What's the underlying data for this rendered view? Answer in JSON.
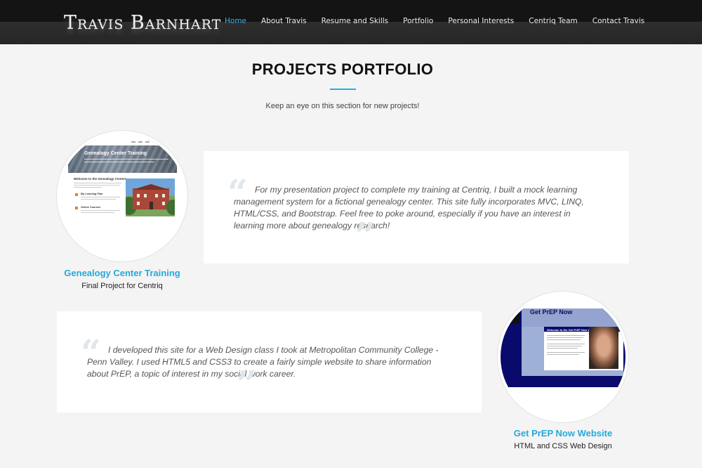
{
  "header": {
    "brand": "Travis Barnhart",
    "nav": [
      {
        "label": "Home",
        "active": true
      },
      {
        "label": "About Travis",
        "active": false
      },
      {
        "label": "Resume and Skills",
        "active": false
      },
      {
        "label": "Portfolio",
        "active": false
      },
      {
        "label": "Personal Interests",
        "active": false
      },
      {
        "label": "Centriq Team",
        "active": false
      },
      {
        "label": "Contact Travis",
        "active": false
      }
    ]
  },
  "section": {
    "title": "PROJECTS PORTFOLIO",
    "subtitle": "Keep an eye on this section for new projects!"
  },
  "projects": [
    {
      "name": "Genealogy Center Training",
      "subtitle": "Final Project for Centriq",
      "quote": "For my presentation project to complete my training at Centriq, I built a mock learning management system for a fictional genealogy center. This site fully incorporates MVC, LINQ, HTML/CSS, and Bootstrap. Feel free to poke around, especially if you have an interest in learning more about genealogy research!",
      "thumb": {
        "banner_title": "Genealogy Center Training",
        "welcome": "Welcome to the Genealogy Center!",
        "item1": "My Learning Plan",
        "item2": "Online Courses"
      }
    },
    {
      "name": "Get PrEP Now Website",
      "subtitle": "HTML and CSS Web Design",
      "quote": "I developed this site for a Web Design class I took at Metropolitan Community College - Penn Valley. I used HTML5 and CSS3 to create a fairly simple website to share information about PrEP, a topic of interest in my social work career.",
      "thumb": {
        "banner_title": "Get PrEP Now",
        "welcome": "Welcome to the Get PrEP Now Website!"
      }
    }
  ],
  "colors": {
    "accent": "#26a9d9",
    "nav_active": "#39b2e3",
    "background": "#f4f4f4"
  }
}
